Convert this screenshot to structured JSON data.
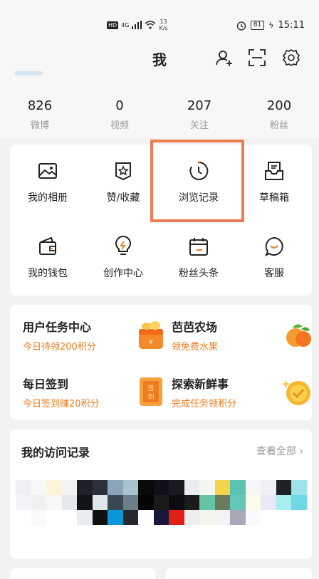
{
  "status_bar": {
    "hd": "HD",
    "network": "4G",
    "speed_value": "13",
    "speed_unit": "K/s",
    "battery": "81",
    "time": "15:11"
  },
  "header": {
    "title": "我"
  },
  "stats": [
    {
      "num": "826",
      "label": "微博"
    },
    {
      "num": "0",
      "label": "视频"
    },
    {
      "num": "207",
      "label": "关注"
    },
    {
      "num": "200",
      "label": "粉丝"
    }
  ],
  "grid": [
    {
      "label": "我的相册",
      "icon": "album-icon"
    },
    {
      "label": "赞/收藏",
      "icon": "favorite-icon"
    },
    {
      "label": "浏览记录",
      "icon": "history-icon"
    },
    {
      "label": "草稿箱",
      "icon": "drafts-icon"
    },
    {
      "label": "我的钱包",
      "icon": "wallet-icon"
    },
    {
      "label": "创作中心",
      "icon": "creator-bulb-icon"
    },
    {
      "label": "粉丝头条",
      "icon": "fans-headline-icon"
    },
    {
      "label": "客服",
      "icon": "customer-service-icon"
    }
  ],
  "tasks": [
    {
      "title": "用户任务中心",
      "sub": "今日待领200积分",
      "icon": "gift-box-icon"
    },
    {
      "title": "芭芭农场",
      "sub": "领免费水果",
      "icon": "fruit-icon"
    },
    {
      "title": "每日签到",
      "sub": "今日签到赚20积分",
      "icon": "signin-envelope-icon"
    },
    {
      "title": "探索新鲜事",
      "sub": "完成任务领积分",
      "icon": "check-coin-icon"
    }
  ],
  "visits": {
    "title": "我的访问记录",
    "more": "查看全部"
  },
  "colors": {
    "accent": "#f07b1c",
    "highlight": "#f07b52"
  }
}
